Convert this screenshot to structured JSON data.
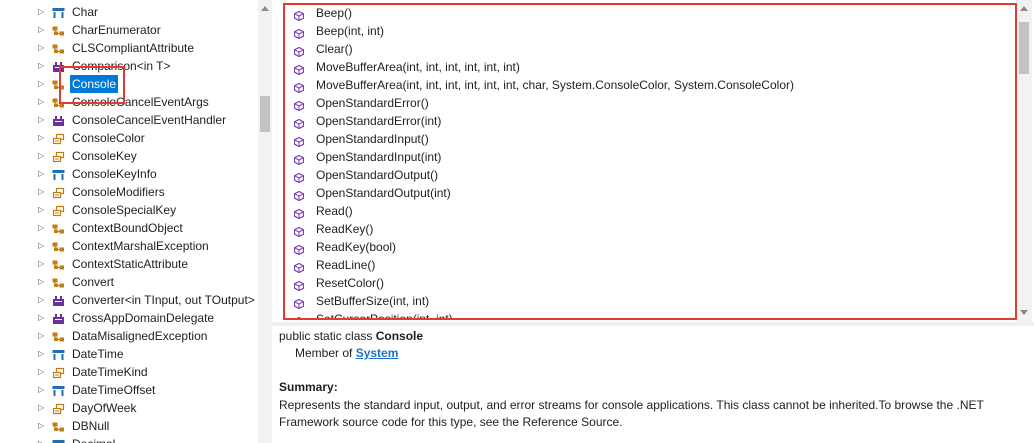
{
  "types": [
    {
      "label": "Char",
      "icon": "struct-icon",
      "color": "#1f6fb5",
      "expanded": false
    },
    {
      "label": "CharEnumerator",
      "icon": "class-icon",
      "color": "#c27d0e",
      "expanded": false
    },
    {
      "label": "CLSCompliantAttribute",
      "icon": "class-icon",
      "color": "#c27d0e",
      "expanded": false
    },
    {
      "label": "Comparison<in T>",
      "icon": "delegate-icon",
      "color": "#6b2fa0",
      "expanded": false
    },
    {
      "label": "Console",
      "icon": "class-icon",
      "color": "#c27d0e",
      "expanded": false,
      "selected": true
    },
    {
      "label": "ConsoleCancelEventArgs",
      "icon": "class-icon",
      "color": "#c27d0e",
      "expanded": false
    },
    {
      "label": "ConsoleCancelEventHandler",
      "icon": "delegate-icon",
      "color": "#6b2fa0",
      "expanded": false
    },
    {
      "label": "ConsoleColor",
      "icon": "enum-icon",
      "color": "#c27d0e",
      "expanded": false
    },
    {
      "label": "ConsoleKey",
      "icon": "enum-icon",
      "color": "#c27d0e",
      "expanded": false
    },
    {
      "label": "ConsoleKeyInfo",
      "icon": "struct-icon",
      "color": "#1f6fb5",
      "expanded": false
    },
    {
      "label": "ConsoleModifiers",
      "icon": "enum-icon",
      "color": "#c27d0e",
      "expanded": false
    },
    {
      "label": "ConsoleSpecialKey",
      "icon": "enum-icon",
      "color": "#c27d0e",
      "expanded": false
    },
    {
      "label": "ContextBoundObject",
      "icon": "class-icon",
      "color": "#c27d0e",
      "expanded": false
    },
    {
      "label": "ContextMarshalException",
      "icon": "class-icon",
      "color": "#c27d0e",
      "expanded": false
    },
    {
      "label": "ContextStaticAttribute",
      "icon": "class-icon",
      "color": "#c27d0e",
      "expanded": false
    },
    {
      "label": "Convert",
      "icon": "class-icon",
      "color": "#c27d0e",
      "expanded": false
    },
    {
      "label": "Converter<in TInput, out TOutput>",
      "icon": "delegate-icon",
      "color": "#6b2fa0",
      "expanded": false
    },
    {
      "label": "CrossAppDomainDelegate",
      "icon": "delegate-icon",
      "color": "#6b2fa0",
      "expanded": false
    },
    {
      "label": "DataMisalignedException",
      "icon": "class-icon",
      "color": "#c27d0e",
      "expanded": false
    },
    {
      "label": "DateTime",
      "icon": "struct-icon",
      "color": "#1f6fb5",
      "expanded": false
    },
    {
      "label": "DateTimeKind",
      "icon": "enum-icon",
      "color": "#c27d0e",
      "expanded": false
    },
    {
      "label": "DateTimeOffset",
      "icon": "struct-icon",
      "color": "#1f6fb5",
      "expanded": false
    },
    {
      "label": "DayOfWeek",
      "icon": "enum-icon",
      "color": "#c27d0e",
      "expanded": false
    },
    {
      "label": "DBNull",
      "icon": "class-icon",
      "color": "#c27d0e",
      "expanded": false
    },
    {
      "label": "Decimal",
      "icon": "struct-icon",
      "color": "#1f6fb5",
      "expanded": false
    }
  ],
  "members": [
    "Beep()",
    "Beep(int, int)",
    "Clear()",
    "MoveBufferArea(int, int, int, int, int, int)",
    "MoveBufferArea(int, int, int, int, int, int, char, System.ConsoleColor, System.ConsoleColor)",
    "OpenStandardError()",
    "OpenStandardError(int)",
    "OpenStandardInput()",
    "OpenStandardInput(int)",
    "OpenStandardOutput()",
    "OpenStandardOutput(int)",
    "Read()",
    "ReadKey()",
    "ReadKey(bool)",
    "ReadLine()",
    "ResetColor()",
    "SetBufferSize(int, int)",
    "SetCursorPosition(int, int)"
  ],
  "member_icon_color": "#7b3fb8",
  "details": {
    "declaration_prefix": "public static class ",
    "declaration_name": "Console",
    "member_of_prefix": "Member of ",
    "member_of_link": "System",
    "summary_heading": "Summary:",
    "summary_text": "Represents the standard input, output, and error streams for console applications. This class cannot be inherited.To browse the .NET Framework source code for this type, see the Reference Source."
  },
  "highlight_color": "#e53935",
  "selection_color": "#0078d7"
}
